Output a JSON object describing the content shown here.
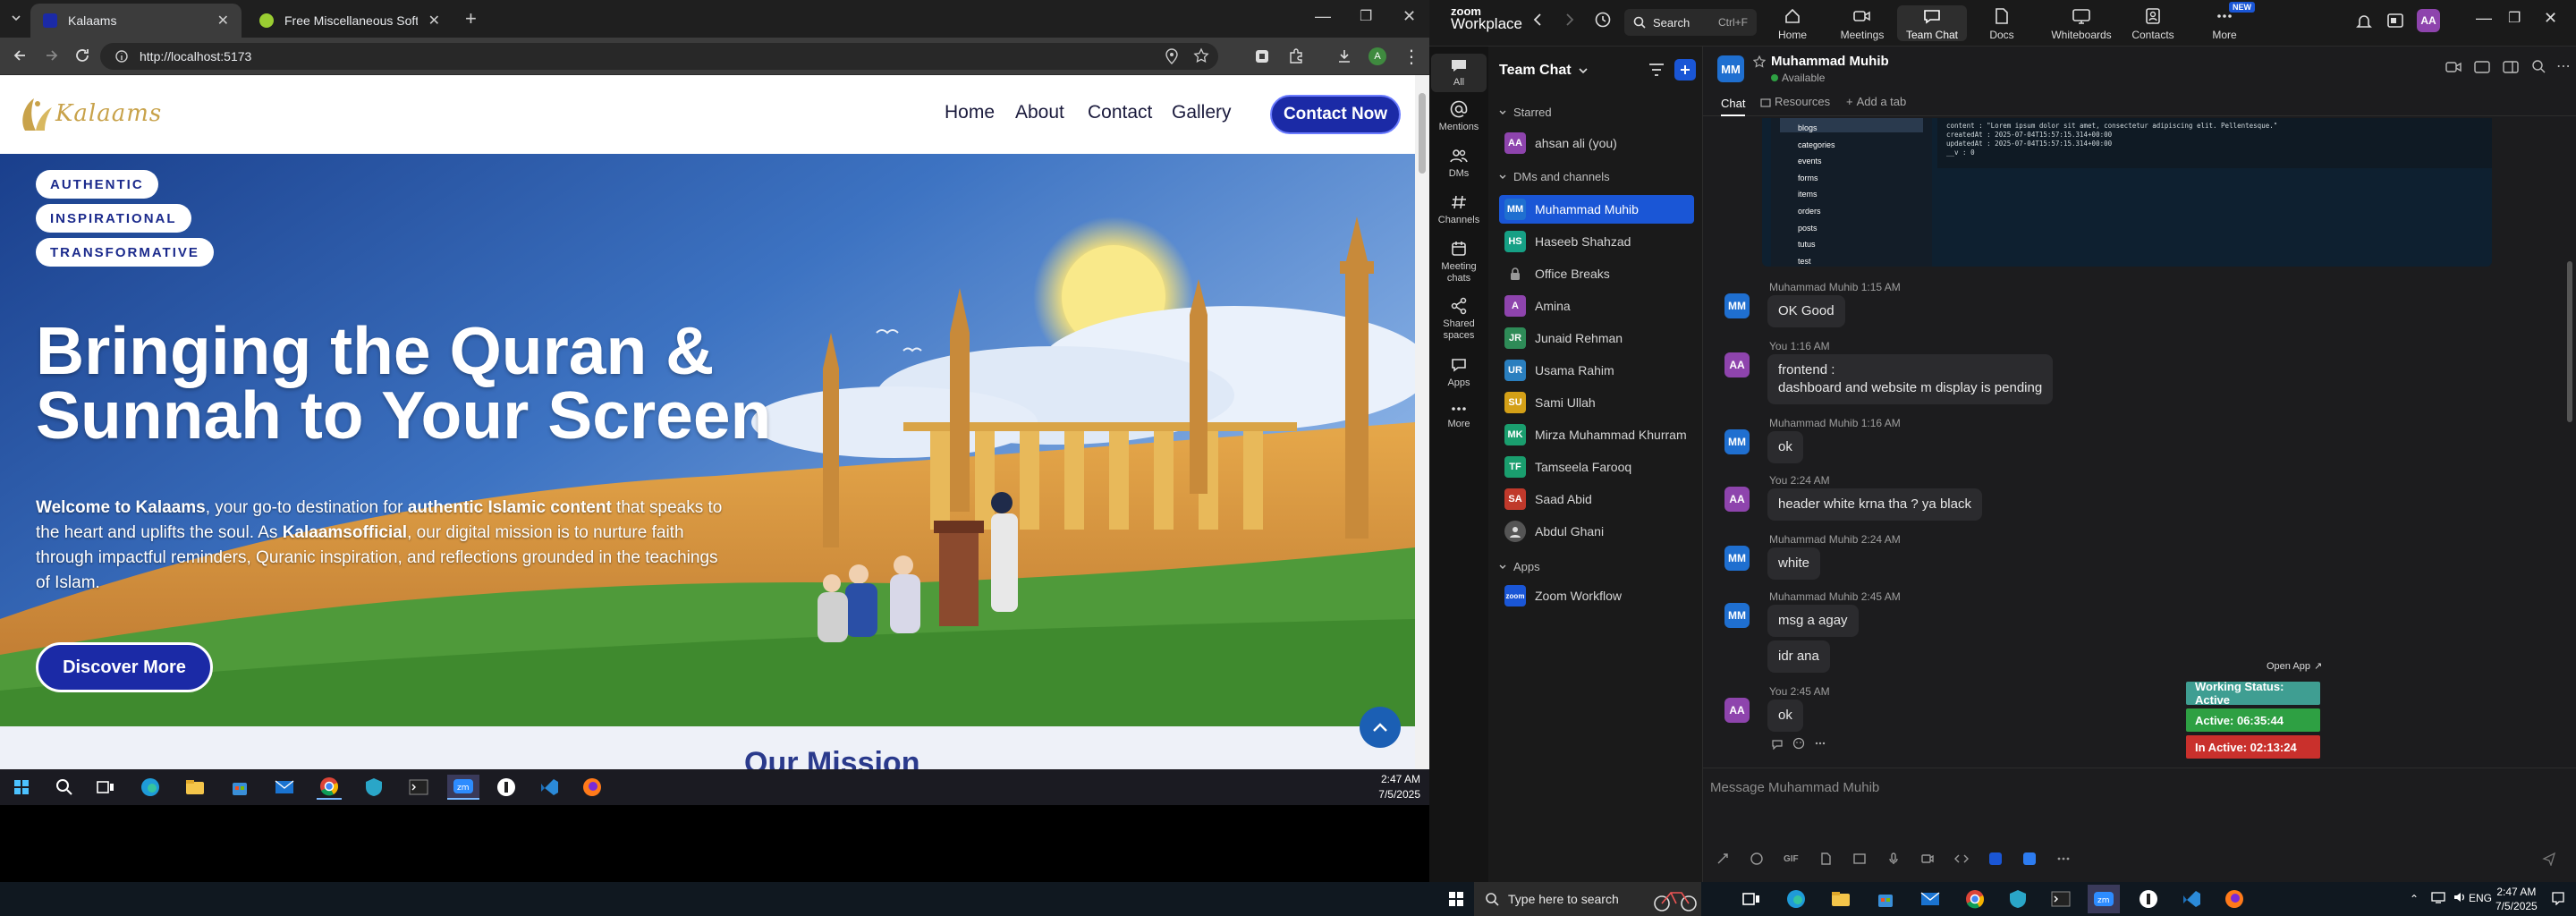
{
  "browser": {
    "tabs": [
      {
        "title": "Kalaams",
        "active": true
      },
      {
        "title": "Free Miscellaneous Software - I",
        "active": false
      }
    ],
    "url": "http://localhost:5173"
  },
  "site": {
    "logo_text": "Kalaams",
    "nav": [
      "Home",
      "About",
      "Contact",
      "Gallery"
    ],
    "cta": "Contact Now",
    "pills": [
      "AUTHENTIC",
      "INSPIRATIONAL",
      "TRANSFORMATIVE"
    ],
    "title_line1": "Bringing the Quran &",
    "title_line2": "Sunnah to Your Screen",
    "subtitle_parts": [
      "Welcome to Kalaams",
      ", your go-to destination for ",
      "authentic Islamic content",
      " that speaks to the heart and uplifts the soul. As ",
      "Kalaamsofficial",
      ", our digital mission is to nurture faith through impactful reminders, Quranic inspiration, and reflections grounded in the teachings of Islam."
    ],
    "discover": "Discover More",
    "below_heading": "Our Mission"
  },
  "left_taskbar": {
    "time": "2:47 AM",
    "date": "7/5/2025"
  },
  "zoom": {
    "brand_top": "zoom",
    "brand": "Workplace",
    "search": "Search",
    "search_shortcut": "Ctrl+F",
    "nav": [
      {
        "label": "Home",
        "icon": "home-icon"
      },
      {
        "label": "Meetings",
        "icon": "video-icon"
      },
      {
        "label": "Team Chat",
        "icon": "chat-icon",
        "active": true
      },
      {
        "label": "Docs",
        "icon": "doc-icon"
      },
      {
        "label": "Whiteboards",
        "icon": "whiteboard-icon"
      },
      {
        "label": "Contacts",
        "icon": "contacts-icon"
      },
      {
        "label": "More",
        "icon": "more-icon",
        "badge": "NEW"
      }
    ],
    "user_initials": "AA",
    "side": [
      {
        "label": "All",
        "icon": "chat-bubble-icon"
      },
      {
        "label": "Mentions",
        "icon": "at-icon"
      },
      {
        "label": "DMs",
        "icon": "people-icon"
      },
      {
        "label": "Channels",
        "icon": "hash-icon"
      },
      {
        "label": "Meeting chats",
        "icon": "calendar-icon"
      },
      {
        "label": "Shared spaces",
        "icon": "share-icon"
      },
      {
        "label": "Apps",
        "icon": "apps-icon"
      },
      {
        "label": "More",
        "icon": "dots-icon"
      }
    ],
    "list_title": "Team Chat",
    "sections": {
      "starred": "Starred",
      "dms": "DMs and channels",
      "apps": "Apps"
    },
    "starred": [
      {
        "name": "ahsan ali (you)",
        "initials": "AA",
        "color": "#8e44ad"
      }
    ],
    "contacts": [
      {
        "name": "Muhammad Muhib",
        "initials": "MM",
        "color": "#1f6fd0",
        "selected": true
      },
      {
        "name": "Haseeb Shahzad",
        "initials": "HS",
        "color": "#16a085"
      },
      {
        "name": "Office Breaks",
        "initials": "",
        "color": "#1a1a1a"
      },
      {
        "name": "Amina",
        "initials": "A",
        "color": "#8e44ad"
      },
      {
        "name": "Junaid Rehman",
        "initials": "JR",
        "color": "#2e8b57"
      },
      {
        "name": "Usama Rahim",
        "initials": "UR",
        "color": "#2a7fbf"
      },
      {
        "name": "Sami Ullah",
        "initials": "SU",
        "color": "#d4a017"
      },
      {
        "name": "Mirza Muhammad Khurram",
        "initials": "MK",
        "color": "#1a9e6e"
      },
      {
        "name": "Tamseela Farooq",
        "initials": "TF",
        "color": "#1a9e6e"
      },
      {
        "name": "Saad Abid",
        "initials": "SA",
        "color": "#c0392b"
      },
      {
        "name": "Abdul Ghani",
        "initials": "",
        "color": "#555"
      }
    ],
    "apps": [
      {
        "name": "Zoom Workflow",
        "initials": "zoom",
        "color": "#1a56d6"
      }
    ],
    "chat_header": {
      "name": "Muhammad Muhib",
      "status": "Available",
      "initials": "MM"
    },
    "chat_tabs": [
      "Chat",
      "Resources",
      "Add a tab"
    ],
    "code_lines": [
      "content : \"Lorem ipsum dolor sit amet, consectetur adipiscing elit. Pellentesque.\"",
      "createdAt : 2025-07-04T15:57:15.314+00:00",
      "updatedAt : 2025-07-04T15:57:15.314+00:00",
      "__v : 0"
    ],
    "folders": [
      "blogs",
      "categories",
      "events",
      "forms",
      "items",
      "orders",
      "posts",
      "tutus",
      "test"
    ],
    "messages": [
      {
        "who": "MM",
        "name": "Muhammad Muhib",
        "time": "1:15 AM",
        "lines": [
          "OK Good"
        ]
      },
      {
        "who": "AA",
        "name": "You",
        "time": "1:16 AM",
        "lines": [
          "frontend :",
          "dashboard and website m display is pending"
        ]
      },
      {
        "who": "MM",
        "name": "Muhammad Muhib",
        "time": "1:16 AM",
        "lines": [
          "ok"
        ]
      },
      {
        "who": "AA",
        "name": "You",
        "time": "2:24 AM",
        "lines": [
          "header white krna tha ? ya black"
        ]
      },
      {
        "who": "MM",
        "name": "Muhammad Muhib",
        "time": "2:24 AM",
        "lines": [
          "white"
        ]
      },
      {
        "who": "MM",
        "name": "Muhammad Muhib",
        "time": "2:45 AM",
        "lines": [
          "msg a agay"
        ]
      },
      {
        "who": "",
        "name": "",
        "time": "",
        "lines": [
          "idr ana"
        ]
      },
      {
        "who": "AA",
        "name": "You",
        "time": "2:45 AM",
        "lines": [
          "ok"
        ]
      }
    ],
    "work_status": {
      "open_app": "Open App",
      "status": "Working Status: Active",
      "active": "Active: 06:35:44",
      "inactive": "In Active: 02:13:24"
    },
    "compose_placeholder": "Message Muhammad Muhib"
  },
  "win_taskbar": {
    "search_placeholder": "Type here to search",
    "time": "2:47 AM",
    "date": "7/5/2025"
  },
  "colors": {
    "site_blue": "#1b2aa6",
    "zoom_blue": "#1a56d6",
    "status_teal": "#3f9e92",
    "status_green": "#2ea043",
    "status_red": "#c9302c"
  }
}
